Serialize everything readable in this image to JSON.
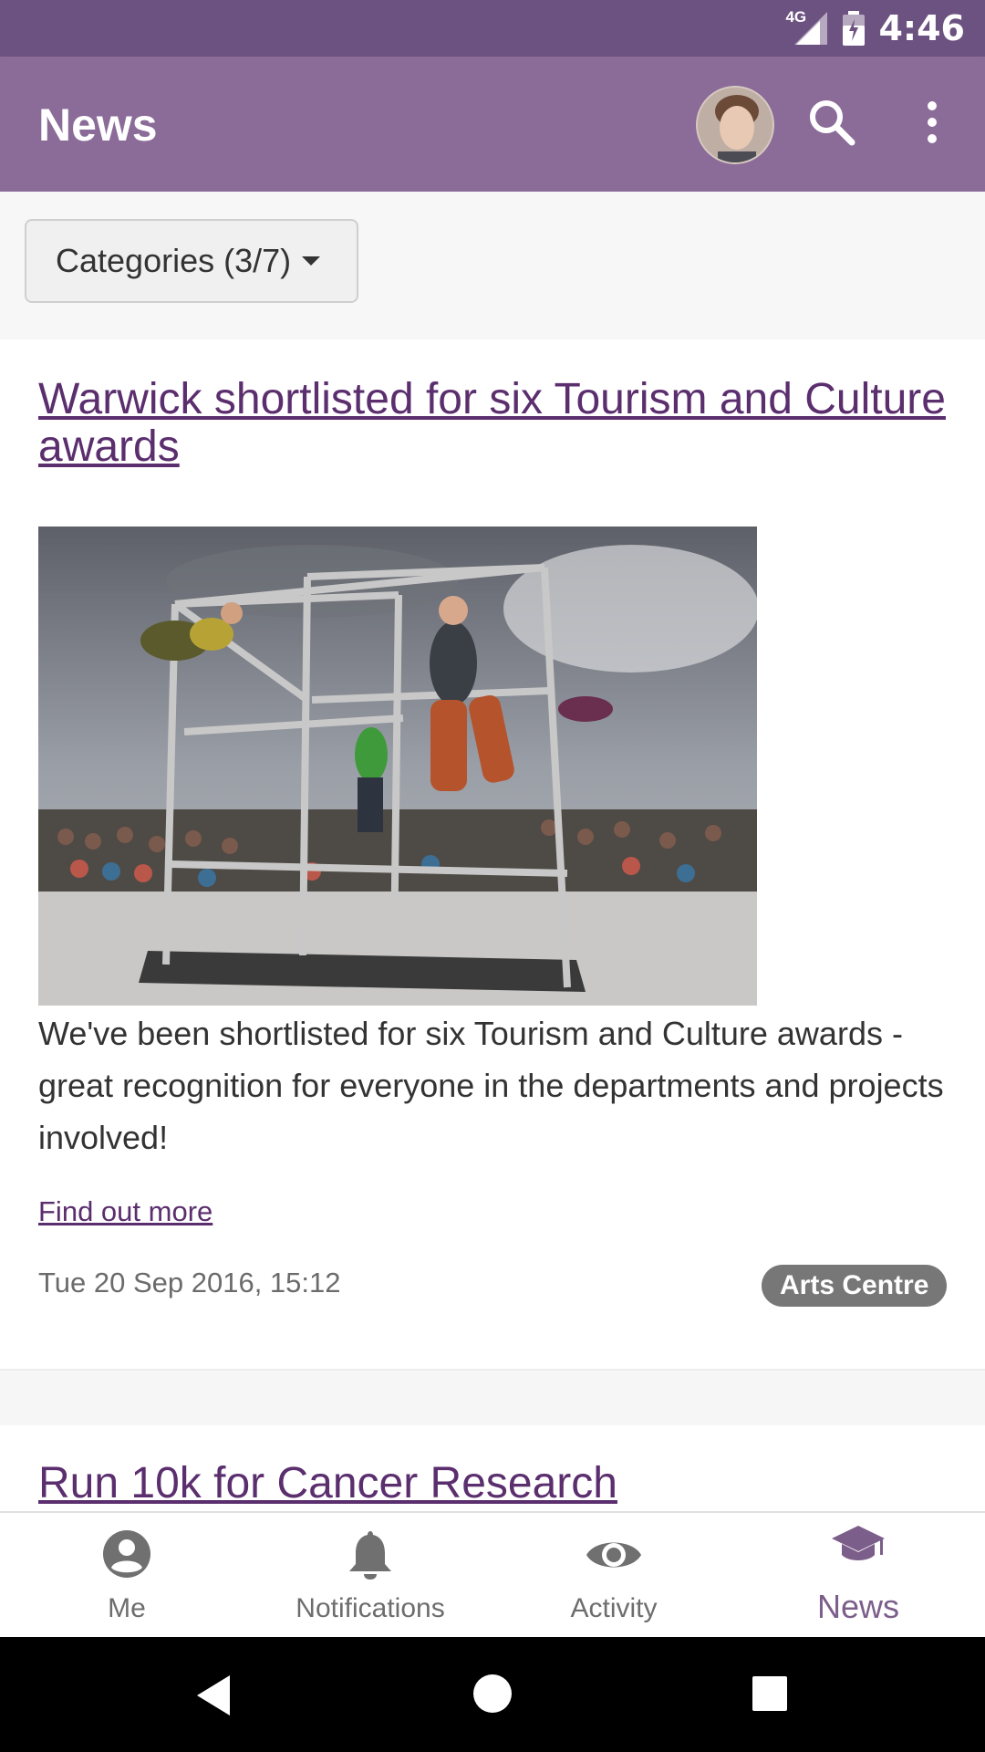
{
  "status_bar": {
    "network": "4G",
    "time": "4:46"
  },
  "app_bar": {
    "title": "News"
  },
  "filter": {
    "categories_label": "Categories (3/7)"
  },
  "articles": [
    {
      "title": "Warwick shortlisted for six Tourism and Culture awards",
      "summary": "We've been shortlisted for six Tourism and Culture awards - great recognition for everyone in the departments and projects involved!",
      "link_label": "Find out more",
      "date": "Tue 20 Sep 2016, 15:12",
      "tag": "Arts Centre"
    },
    {
      "title": "Run 10k for Cancer Research"
    }
  ],
  "bottom_nav": {
    "items": [
      {
        "label": "Me",
        "icon": "account-circle-icon"
      },
      {
        "label": "Notifications",
        "icon": "bell-icon"
      },
      {
        "label": "Activity",
        "icon": "eye-icon"
      },
      {
        "label": "News",
        "icon": "graduation-cap-icon",
        "active": true
      }
    ]
  },
  "colors": {
    "status_bar": "#6c5280",
    "app_bar": "#8b6b98",
    "link": "#5b2e6e",
    "active_nav": "#7c5e8b",
    "badge": "#777777"
  }
}
